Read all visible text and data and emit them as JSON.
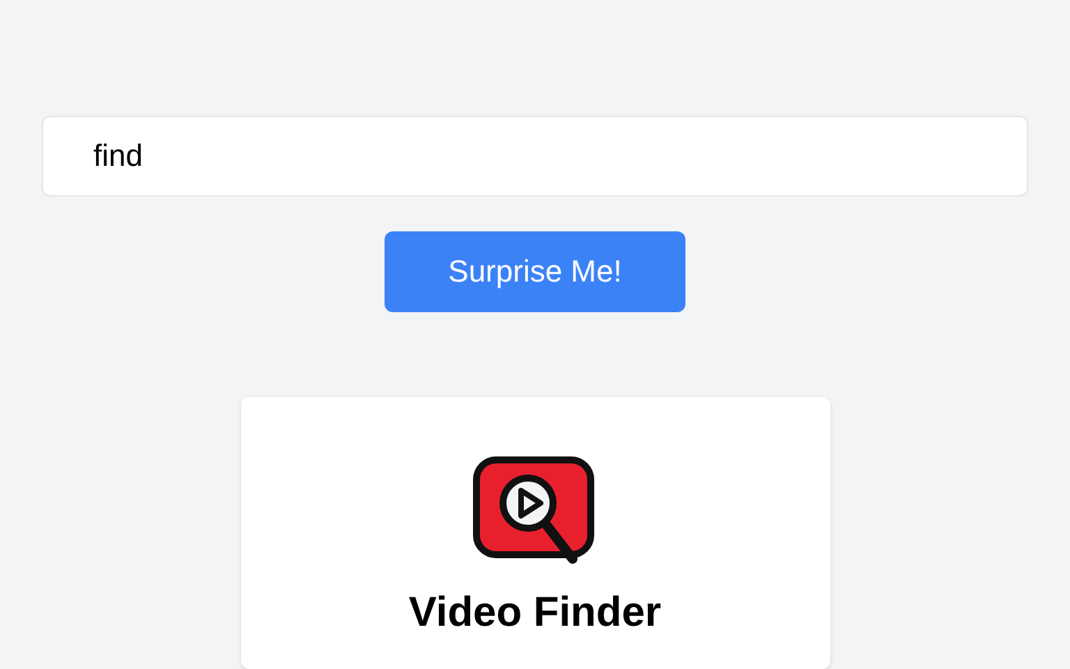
{
  "search": {
    "value": "find"
  },
  "button": {
    "label": "Surprise Me!"
  },
  "card": {
    "title": "Video Finder"
  }
}
